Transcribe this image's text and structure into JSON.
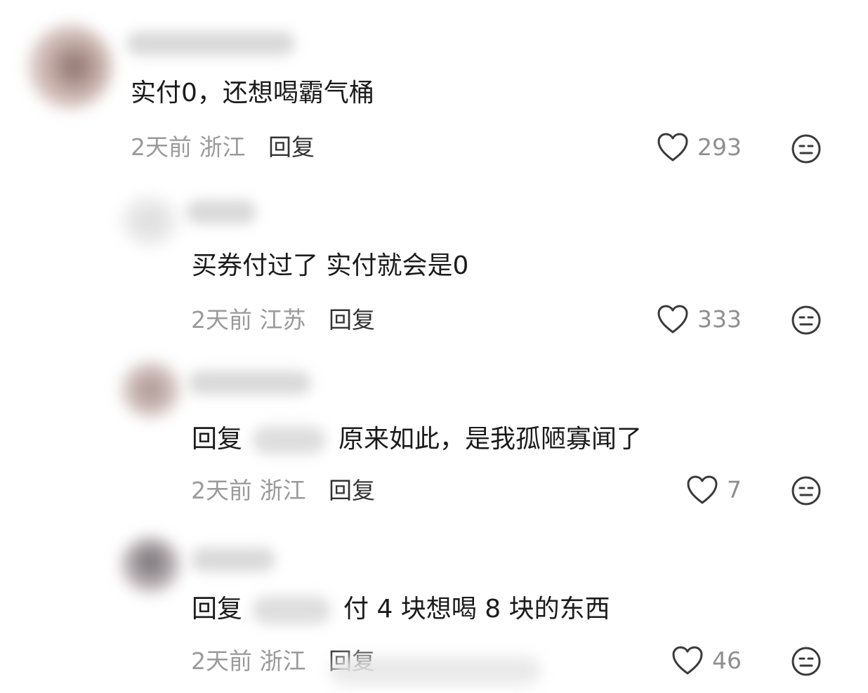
{
  "comments": [
    {
      "text": "实付0，还想喝霸气桶",
      "time": "2天前",
      "location": "浙江",
      "reply_label": "回复",
      "likes": "293"
    },
    {
      "text": "买券付过了 实付就会是0",
      "time": "2天前",
      "location": "江苏",
      "reply_label": "回复",
      "likes": "333"
    },
    {
      "reply_prefix": "回复",
      "text": "原来如此，是我孤陋寡闻了",
      "time": "2天前",
      "location": "浙江",
      "reply_label": "回复",
      "likes": "7"
    },
    {
      "reply_prefix": "回复",
      "text": "付 4 块想喝 8 块的东西",
      "time": "2天前",
      "location": "浙江",
      "reply_label": "回复",
      "likes": "46"
    }
  ],
  "icons": {
    "like": "heart-outline-icon",
    "dislike": "neutral-face-icon"
  },
  "colors": {
    "meta_text": "#9a9a9a",
    "body_text": "#1b1b1b",
    "icon_stroke": "#3a3a3a"
  }
}
